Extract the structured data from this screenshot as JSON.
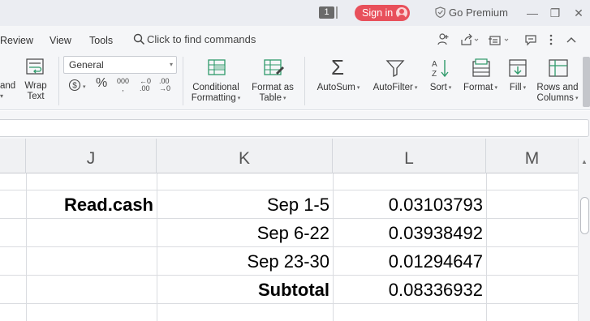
{
  "titlebar": {
    "badge": "1",
    "sign_in": "Sign in",
    "go_premium": "Go Premium",
    "minimize": "—",
    "restore": "❐",
    "close": "✕"
  },
  "menu": {
    "items": [
      "Review",
      "View",
      "Tools"
    ],
    "find_commands": "Click to find commands"
  },
  "ribbon": {
    "partial_left_top": "and",
    "wrap_text": [
      "Wrap",
      "Text"
    ],
    "number_format": "General",
    "currency": "$",
    "percent": "%",
    "thousands": "000",
    "inc_decimal": ".00",
    "dec_decimal": ".00",
    "conditional_formatting": [
      "Conditional",
      "Formatting"
    ],
    "format_as_table": [
      "Format as",
      "Table"
    ],
    "autosum": "AutoSum",
    "autofilter": "AutoFilter",
    "sort": "Sort",
    "format": "Format",
    "fill": "Fill",
    "rows_and_columns": [
      "Rows and",
      "Columns"
    ]
  },
  "grid": {
    "columns": [
      "J",
      "K",
      "L",
      "M"
    ],
    "rows": [
      {
        "j": "Read.cash",
        "k": "Sep 1-5",
        "l": "0.03103793"
      },
      {
        "j": "",
        "k": "Sep 6-22",
        "l": "0.03938492"
      },
      {
        "j": "",
        "k": "Sep 23-30",
        "l": "0.01294647"
      },
      {
        "j": "",
        "k": "Subtotal",
        "l": "0.08336932"
      }
    ]
  },
  "colors": {
    "sign_in_bg": "#e8505b",
    "ribbon_bg": "#f5f6f8",
    "header_bg": "#f0f1f3"
  }
}
